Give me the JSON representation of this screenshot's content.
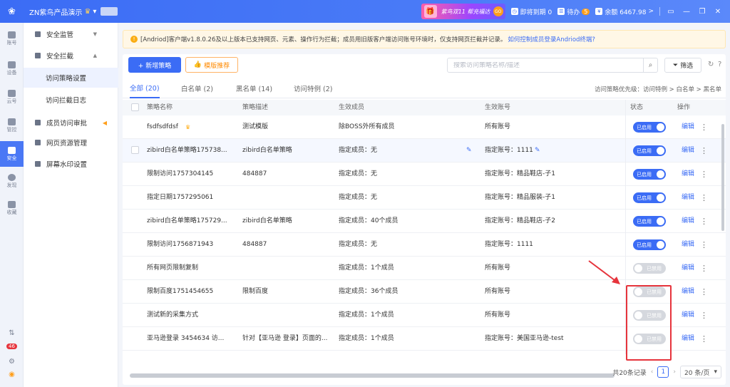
{
  "topbar": {
    "brand": "ZN紫鸟产品演示",
    "promo": "紫鸟双11 帮充福达",
    "promo_go": "GO",
    "expiring_label": "即将到期 0",
    "todo_label": "待办",
    "todo_count": "5",
    "balance_label": "余额 6467.98",
    "balance_arrow": ">"
  },
  "rail": {
    "items": [
      "账号",
      "设备",
      "云号",
      "管控",
      "安全",
      "发现",
      "收藏"
    ],
    "badge": "46"
  },
  "menu": {
    "security_monitor": "安全监管",
    "security_intercept": "安全拦截",
    "access_policy": "访问策略设置",
    "intercept_log": "访问拦截日志",
    "member_approval": "成员访问审批",
    "resource_mgmt": "网页资源管理",
    "watermark": "屏幕水印设置"
  },
  "notice": {
    "text": "[Andriod]客户端v1.8.0.26及以上版本已支持网页、元素、操作行为拦截；成员用旧版客户端访问账号环境时，仅支持网页拦截并记录。",
    "link": "如何控制成员登录Andriod终端?"
  },
  "toolbar": {
    "add_label": "+ 新增策略",
    "template_label": "模版推荐",
    "search_placeholder": "搜索访问策略名称/描述",
    "filter_label": "筛选"
  },
  "tabs": [
    "全部 (20)",
    "白名单 (2)",
    "黑名单 (14)",
    "访问特例 (2)"
  ],
  "priority_text": "访问策略优先级：访问特例 > 白名单 > 黑名单",
  "table": {
    "headers": [
      "策略名称",
      "策略描述",
      "生效成员",
      "生效账号",
      "状态",
      "操作"
    ],
    "rows": [
      {
        "name": "fsdfsdfdsf",
        "desc": "测试模版",
        "members": "除BOSS外所有成员",
        "accounts": "所有账号",
        "status": "已启用",
        "on": true
      },
      {
        "name": "zibird白名单策略175738...",
        "desc": "zibird白名单策略",
        "members": "指定成员：无",
        "accounts": "指定账号：1111",
        "status": "已启用",
        "on": true
      },
      {
        "name": "限制访问1757304145",
        "desc": "484887",
        "members": "指定成员：无",
        "accounts": "指定账号：精品鞋店-子1",
        "status": "已启用",
        "on": true
      },
      {
        "name": "指定日期1757295061",
        "desc": "",
        "members": "指定成员：无",
        "accounts": "指定账号：精品服装-子1",
        "status": "已启用",
        "on": true
      },
      {
        "name": "zibird白名单策略175729...",
        "desc": "zibird白名单策略",
        "members": "指定成员：40个成员",
        "accounts": "指定账号：精品鞋店-子2",
        "status": "已启用",
        "on": true
      },
      {
        "name": "限制访问1756871943",
        "desc": "484887",
        "members": "指定成员：无",
        "accounts": "指定账号：1111",
        "status": "已启用",
        "on": true
      },
      {
        "name": "所有网页限制复制",
        "desc": "",
        "members": "指定成员：1个成员",
        "accounts": "所有账号",
        "status": "已禁用",
        "on": false
      },
      {
        "name": "限制百度1751454655",
        "desc": "限制百度",
        "members": "指定成员：36个成员",
        "accounts": "所有账号",
        "status": "已禁用",
        "on": false
      },
      {
        "name": "测试新的采集方式",
        "desc": "",
        "members": "指定成员：1个成员",
        "accounts": "所有账号",
        "status": "已禁用",
        "on": false
      },
      {
        "name": "亚马逊登录 3454634 访...",
        "desc": "针对【亚马逊 登录】页面的...",
        "members": "指定成员：1个成员",
        "accounts": "指定账号：美国亚马逊-test",
        "status": "已禁用",
        "on": false
      }
    ],
    "edit_label": "编辑",
    "more_label": "⋮"
  },
  "pager": {
    "total": "共20条记录",
    "page": "1",
    "size": "20 条/页"
  }
}
